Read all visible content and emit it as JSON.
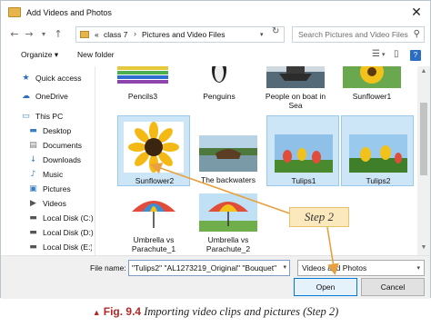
{
  "window": {
    "title": "Add Videos and Photos",
    "close_glyph": "✕"
  },
  "address": {
    "back_glyph": "←",
    "forward_glyph": "→",
    "recent_glyph": "▾",
    "up_glyph": "↑",
    "prefix": "«",
    "crumbs": [
      "class 7",
      "Pictures and Video Files"
    ],
    "sep": "›",
    "dropdown_glyph": "▾",
    "refresh_glyph": "↻",
    "search_placeholder": "Search Pictures and Video Files",
    "search_glyph": "⚲"
  },
  "toolbar": {
    "organize": "Organize ▾",
    "new_folder": "New folder",
    "view_glyph": "☰",
    "view_drop": "▾",
    "pane_glyph": "▯",
    "help_glyph": "?"
  },
  "sidebar": {
    "items": [
      {
        "label": "Quick access",
        "icon": "★",
        "icon_name": "star-icon"
      },
      {
        "label": "OneDrive",
        "icon": "☁",
        "icon_name": "cloud-icon"
      },
      {
        "label": "This PC",
        "icon": "▭",
        "icon_name": "computer-icon"
      },
      {
        "label": "Desktop",
        "icon": "▬",
        "icon_name": "desktop-icon"
      },
      {
        "label": "Documents",
        "icon": "▤",
        "icon_name": "documents-icon"
      },
      {
        "label": "Downloads",
        "icon": "↓",
        "icon_name": "downloads-icon"
      },
      {
        "label": "Music",
        "icon": "♪",
        "icon_name": "music-icon"
      },
      {
        "label": "Pictures",
        "icon": "▣",
        "icon_name": "pictures-icon"
      },
      {
        "label": "Videos",
        "icon": "▶",
        "icon_name": "videos-icon"
      },
      {
        "label": "Local Disk (C:)",
        "icon": "▬",
        "icon_name": "disk-icon"
      },
      {
        "label": "Local Disk (D:)",
        "icon": "▬",
        "icon_name": "disk-icon"
      },
      {
        "label": "Local Disk (E:)",
        "icon": "▬",
        "icon_name": "disk-icon"
      }
    ]
  },
  "files": {
    "row1": [
      "Pencils3",
      "Penguins",
      "People on boat in Sea",
      "Sunflower1"
    ],
    "row2": [
      "Sunflower2",
      "The backwaters",
      "Tulips1",
      "Tulips2"
    ],
    "row3": [
      "Umbrella vs Parachute_1",
      "Umbrella vs Parachute_2"
    ],
    "selected": [
      "Sunflower2",
      "Tulips1",
      "Tulips2"
    ]
  },
  "bottom": {
    "filename_label": "File name:",
    "filename_value": "\"Tulips2\" \"AL1273219_Original\" \"Bouquet\" \"S",
    "filename_drop": "▾",
    "filetype": "Videos and Photos",
    "filetype_drop": "▾",
    "open": "Open",
    "cancel": "Cancel"
  },
  "annotation": {
    "step": "Step 2",
    "color": "#e8a040"
  },
  "caption": {
    "triangle": "▲",
    "fig": "Fig. 9.4",
    "text": "Importing video clips and pictures (Step 2)"
  },
  "colors": {
    "selection": "#cde6f7",
    "accent": "#0078d7",
    "caption_red": "#b52828"
  }
}
